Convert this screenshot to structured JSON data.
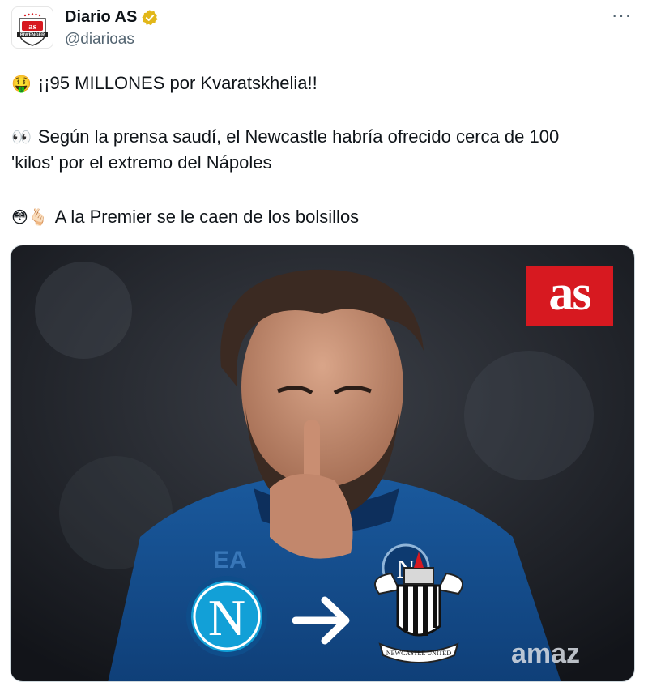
{
  "author": {
    "display_name": "Diario AS",
    "handle": "@diarioas",
    "avatar_text": "as",
    "avatar_subtext": "BIWENGER",
    "verified_icon": "verified-badge-icon"
  },
  "more_label": "···",
  "tweet": {
    "line1_emoji": "🤑",
    "line1_text": "¡¡95 MILLONES por Kvaratskhelia!!",
    "line2_emoji": "👀",
    "line2_text": "Según la prensa saudí, el Newcastle habría ofrecido cerca de 100",
    "line3_text": "'kilos' por el extremo del Nápoles",
    "line4_emoji": "😳🫰🏻",
    "line4_text": "A la Premier se le caen de los bolsillos"
  },
  "media": {
    "logo_text": "as",
    "left_crest_letter": "N",
    "arrow_icon": "right-arrow-icon",
    "jersey_text_left": "EA",
    "jersey_text_right": "amaz",
    "newcastle_crest_text": "NEWCASTLE UNITED"
  },
  "colors": {
    "as_red": "#d71920",
    "verified_gold": "#e2b719",
    "napoli_blue": "#12a0d7",
    "handle_gray": "#536471"
  }
}
